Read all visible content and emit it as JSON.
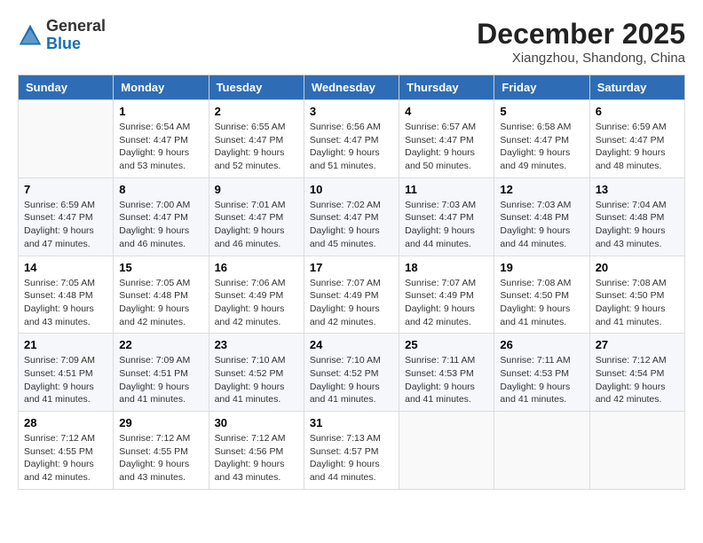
{
  "logo": {
    "line1": "General",
    "line2": "Blue"
  },
  "title": "December 2025",
  "subtitle": "Xiangzhou, Shandong, China",
  "headers": [
    "Sunday",
    "Monday",
    "Tuesday",
    "Wednesday",
    "Thursday",
    "Friday",
    "Saturday"
  ],
  "weeks": [
    [
      {
        "day": "",
        "sunrise": "",
        "sunset": "",
        "daylight": ""
      },
      {
        "day": "1",
        "sunrise": "Sunrise: 6:54 AM",
        "sunset": "Sunset: 4:47 PM",
        "daylight": "Daylight: 9 hours and 53 minutes."
      },
      {
        "day": "2",
        "sunrise": "Sunrise: 6:55 AM",
        "sunset": "Sunset: 4:47 PM",
        "daylight": "Daylight: 9 hours and 52 minutes."
      },
      {
        "day": "3",
        "sunrise": "Sunrise: 6:56 AM",
        "sunset": "Sunset: 4:47 PM",
        "daylight": "Daylight: 9 hours and 51 minutes."
      },
      {
        "day": "4",
        "sunrise": "Sunrise: 6:57 AM",
        "sunset": "Sunset: 4:47 PM",
        "daylight": "Daylight: 9 hours and 50 minutes."
      },
      {
        "day": "5",
        "sunrise": "Sunrise: 6:58 AM",
        "sunset": "Sunset: 4:47 PM",
        "daylight": "Daylight: 9 hours and 49 minutes."
      },
      {
        "day": "6",
        "sunrise": "Sunrise: 6:59 AM",
        "sunset": "Sunset: 4:47 PM",
        "daylight": "Daylight: 9 hours and 48 minutes."
      }
    ],
    [
      {
        "day": "7",
        "sunrise": "Sunrise: 6:59 AM",
        "sunset": "Sunset: 4:47 PM",
        "daylight": "Daylight: 9 hours and 47 minutes."
      },
      {
        "day": "8",
        "sunrise": "Sunrise: 7:00 AM",
        "sunset": "Sunset: 4:47 PM",
        "daylight": "Daylight: 9 hours and 46 minutes."
      },
      {
        "day": "9",
        "sunrise": "Sunrise: 7:01 AM",
        "sunset": "Sunset: 4:47 PM",
        "daylight": "Daylight: 9 hours and 46 minutes."
      },
      {
        "day": "10",
        "sunrise": "Sunrise: 7:02 AM",
        "sunset": "Sunset: 4:47 PM",
        "daylight": "Daylight: 9 hours and 45 minutes."
      },
      {
        "day": "11",
        "sunrise": "Sunrise: 7:03 AM",
        "sunset": "Sunset: 4:47 PM",
        "daylight": "Daylight: 9 hours and 44 minutes."
      },
      {
        "day": "12",
        "sunrise": "Sunrise: 7:03 AM",
        "sunset": "Sunset: 4:48 PM",
        "daylight": "Daylight: 9 hours and 44 minutes."
      },
      {
        "day": "13",
        "sunrise": "Sunrise: 7:04 AM",
        "sunset": "Sunset: 4:48 PM",
        "daylight": "Daylight: 9 hours and 43 minutes."
      }
    ],
    [
      {
        "day": "14",
        "sunrise": "Sunrise: 7:05 AM",
        "sunset": "Sunset: 4:48 PM",
        "daylight": "Daylight: 9 hours and 43 minutes."
      },
      {
        "day": "15",
        "sunrise": "Sunrise: 7:05 AM",
        "sunset": "Sunset: 4:48 PM",
        "daylight": "Daylight: 9 hours and 42 minutes."
      },
      {
        "day": "16",
        "sunrise": "Sunrise: 7:06 AM",
        "sunset": "Sunset: 4:49 PM",
        "daylight": "Daylight: 9 hours and 42 minutes."
      },
      {
        "day": "17",
        "sunrise": "Sunrise: 7:07 AM",
        "sunset": "Sunset: 4:49 PM",
        "daylight": "Daylight: 9 hours and 42 minutes."
      },
      {
        "day": "18",
        "sunrise": "Sunrise: 7:07 AM",
        "sunset": "Sunset: 4:49 PM",
        "daylight": "Daylight: 9 hours and 42 minutes."
      },
      {
        "day": "19",
        "sunrise": "Sunrise: 7:08 AM",
        "sunset": "Sunset: 4:50 PM",
        "daylight": "Daylight: 9 hours and 41 minutes."
      },
      {
        "day": "20",
        "sunrise": "Sunrise: 7:08 AM",
        "sunset": "Sunset: 4:50 PM",
        "daylight": "Daylight: 9 hours and 41 minutes."
      }
    ],
    [
      {
        "day": "21",
        "sunrise": "Sunrise: 7:09 AM",
        "sunset": "Sunset: 4:51 PM",
        "daylight": "Daylight: 9 hours and 41 minutes."
      },
      {
        "day": "22",
        "sunrise": "Sunrise: 7:09 AM",
        "sunset": "Sunset: 4:51 PM",
        "daylight": "Daylight: 9 hours and 41 minutes."
      },
      {
        "day": "23",
        "sunrise": "Sunrise: 7:10 AM",
        "sunset": "Sunset: 4:52 PM",
        "daylight": "Daylight: 9 hours and 41 minutes."
      },
      {
        "day": "24",
        "sunrise": "Sunrise: 7:10 AM",
        "sunset": "Sunset: 4:52 PM",
        "daylight": "Daylight: 9 hours and 41 minutes."
      },
      {
        "day": "25",
        "sunrise": "Sunrise: 7:11 AM",
        "sunset": "Sunset: 4:53 PM",
        "daylight": "Daylight: 9 hours and 41 minutes."
      },
      {
        "day": "26",
        "sunrise": "Sunrise: 7:11 AM",
        "sunset": "Sunset: 4:53 PM",
        "daylight": "Daylight: 9 hours and 41 minutes."
      },
      {
        "day": "27",
        "sunrise": "Sunrise: 7:12 AM",
        "sunset": "Sunset: 4:54 PM",
        "daylight": "Daylight: 9 hours and 42 minutes."
      }
    ],
    [
      {
        "day": "28",
        "sunrise": "Sunrise: 7:12 AM",
        "sunset": "Sunset: 4:55 PM",
        "daylight": "Daylight: 9 hours and 42 minutes."
      },
      {
        "day": "29",
        "sunrise": "Sunrise: 7:12 AM",
        "sunset": "Sunset: 4:55 PM",
        "daylight": "Daylight: 9 hours and 43 minutes."
      },
      {
        "day": "30",
        "sunrise": "Sunrise: 7:12 AM",
        "sunset": "Sunset: 4:56 PM",
        "daylight": "Daylight: 9 hours and 43 minutes."
      },
      {
        "day": "31",
        "sunrise": "Sunrise: 7:13 AM",
        "sunset": "Sunset: 4:57 PM",
        "daylight": "Daylight: 9 hours and 44 minutes."
      },
      {
        "day": "",
        "sunrise": "",
        "sunset": "",
        "daylight": ""
      },
      {
        "day": "",
        "sunrise": "",
        "sunset": "",
        "daylight": ""
      },
      {
        "day": "",
        "sunrise": "",
        "sunset": "",
        "daylight": ""
      }
    ]
  ]
}
